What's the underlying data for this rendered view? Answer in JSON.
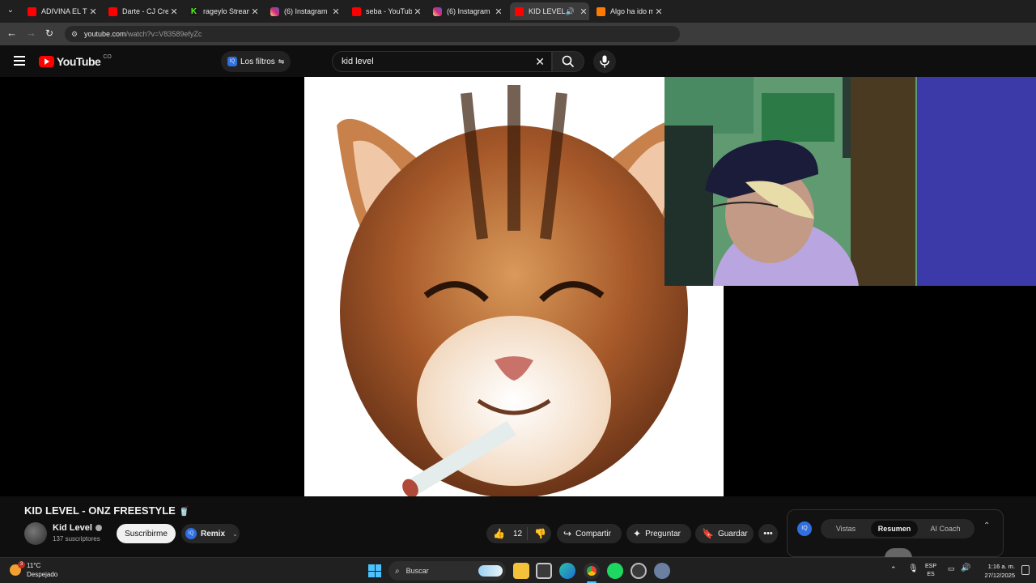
{
  "browser": {
    "tabs": [
      {
        "title": "ADIVINA EL TR",
        "favicon": "youtube-icon",
        "color": "#ff0000"
      },
      {
        "title": "Darte - CJ Crew",
        "favicon": "youtube-icon",
        "color": "#ff0000"
      },
      {
        "title": "rageylo Stream",
        "favicon": "kick-icon",
        "color": "#53fc18"
      },
      {
        "title": "(6) Instagram",
        "favicon": "instagram-icon",
        "color": "#d6249f"
      },
      {
        "title": "seba - YouTub",
        "favicon": "youtube-icon",
        "color": "#ff0000"
      },
      {
        "title": "(6) Instagram",
        "favicon": "instagram-icon",
        "color": "#d6249f"
      },
      {
        "title": "KID LEVEL",
        "favicon": "youtube-icon",
        "color": "#ff0000",
        "active": true
      },
      {
        "title": "Algo ha ido m",
        "favicon": "app-icon",
        "color": "#ff7a00"
      }
    ],
    "url_host": "youtube.com",
    "url_path": "/watch?v=V83589efyZc"
  },
  "youtube": {
    "logo_text": "YouTube",
    "region": "CO",
    "filters_label": "Los filtros",
    "search_value": "kid level"
  },
  "video": {
    "title": "KID LEVEL - ONZ FREESTYLE",
    "title_emoji": "🥤",
    "channel": "Kid Level",
    "subscribers": "137 suscriptores",
    "subscribe_label": "Suscribirme",
    "remix_label": "Remix",
    "likes": "12",
    "share_label": "Compartir",
    "ask_label": "Preguntar",
    "save_label": "Guardar"
  },
  "side_panel": {
    "tabs": [
      "Vistas",
      "Resumen",
      "AI Coach"
    ],
    "active_tab": "Resumen"
  },
  "taskbar": {
    "weather_temp": "11°C",
    "weather_desc": "Despejado",
    "weather_badge": "3",
    "search_placeholder": "Buscar",
    "lang_top": "ESP",
    "lang_bottom": "ES",
    "time": "1:16 a. m.",
    "date": "27/12/2025"
  },
  "colors": {
    "yt_red": "#ff0000",
    "page_bg": "#0f0f0f",
    "accent_blue": "#3ea6ff",
    "vidiq_blue": "#2f6fe0"
  }
}
